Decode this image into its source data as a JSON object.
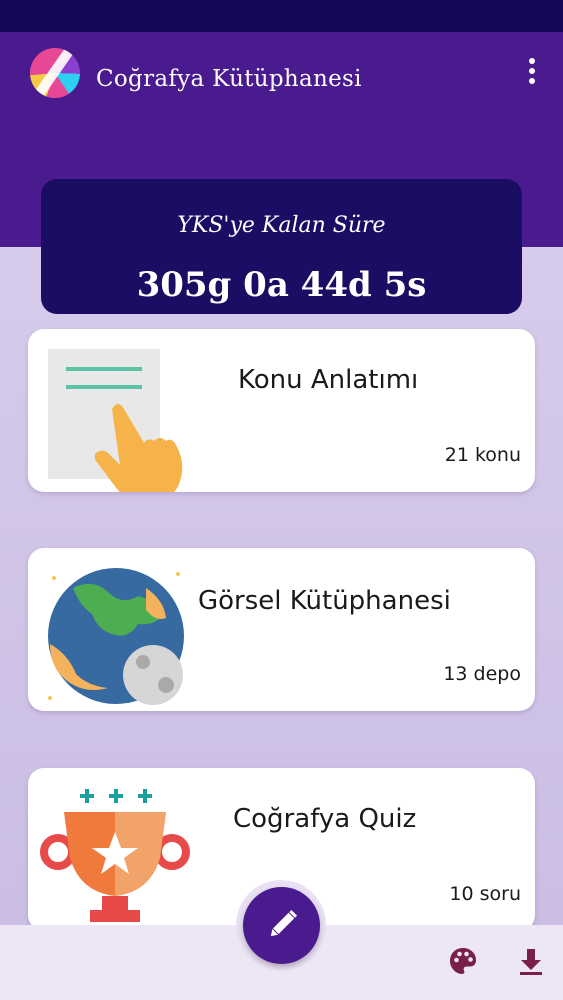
{
  "app": {
    "title": "Coğrafya Kütüphanesi",
    "menu_icon": "more-vertical-icon"
  },
  "countdown": {
    "label": "YKS'ye Kalan Süre",
    "value": "305g 0a 44d 5s"
  },
  "cards": [
    {
      "title": "Konu Anlatımı",
      "count": "21 konu",
      "icon": "hand-pointer-document-icon"
    },
    {
      "title": "Görsel Kütüphanesi",
      "count": "13 depo",
      "icon": "earth-moon-icon"
    },
    {
      "title": "Coğrafya Quiz",
      "count": "10 soru",
      "icon": "trophy-icon"
    }
  ],
  "bottom_bar": {
    "fab_icon": "pencil-icon",
    "palette_icon": "palette-icon",
    "download_icon": "download-icon"
  },
  "colors": {
    "primary": "#4a1a8f",
    "status_bar": "#14085a",
    "countdown_bg": "#1b0d63",
    "background": "#d3c6ea"
  }
}
